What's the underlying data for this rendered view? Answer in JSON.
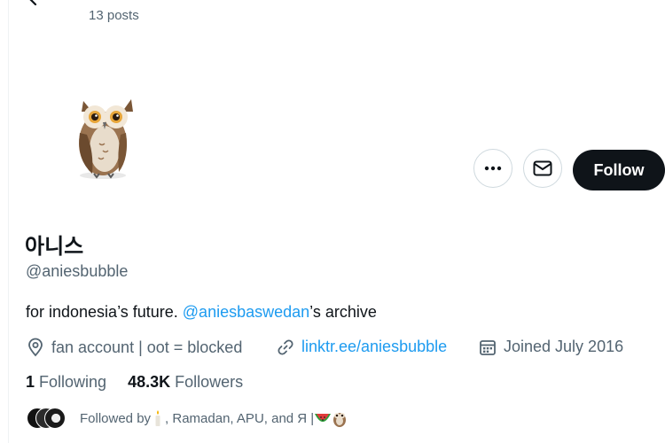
{
  "header": {
    "post_count": "13 posts"
  },
  "profile": {
    "display_name": "아니스",
    "handle": "@aniesbubble",
    "bio": {
      "prefix": "for indonesia’s future. ",
      "mention": "@aniesbaswedan",
      "suffix": "’s archive"
    },
    "location": "fan account | oot = blocked",
    "website": "linktr.ee/aniesbubble",
    "joined": "Joined July 2016",
    "following_count": "1",
    "following_label": "Following",
    "followers_count": "48.3K",
    "followers_label": "Followers",
    "followed_by": {
      "prefix": "Followed by",
      "names": ", Ramadan, APU, and Я | "
    }
  },
  "actions": {
    "follow_label": "Follow"
  },
  "colors": {
    "link": "#1d9bf0",
    "primary_text": "#0f1419",
    "secondary_text": "#536471",
    "follow_button_bg": "#0f1419"
  },
  "icons": {
    "back": "arrow-left-icon",
    "more": "more-horizontal-icon",
    "message": "envelope-icon",
    "location": "location-pin-icon",
    "link": "link-icon",
    "calendar": "calendar-icon",
    "avatar": "owl-icon"
  }
}
